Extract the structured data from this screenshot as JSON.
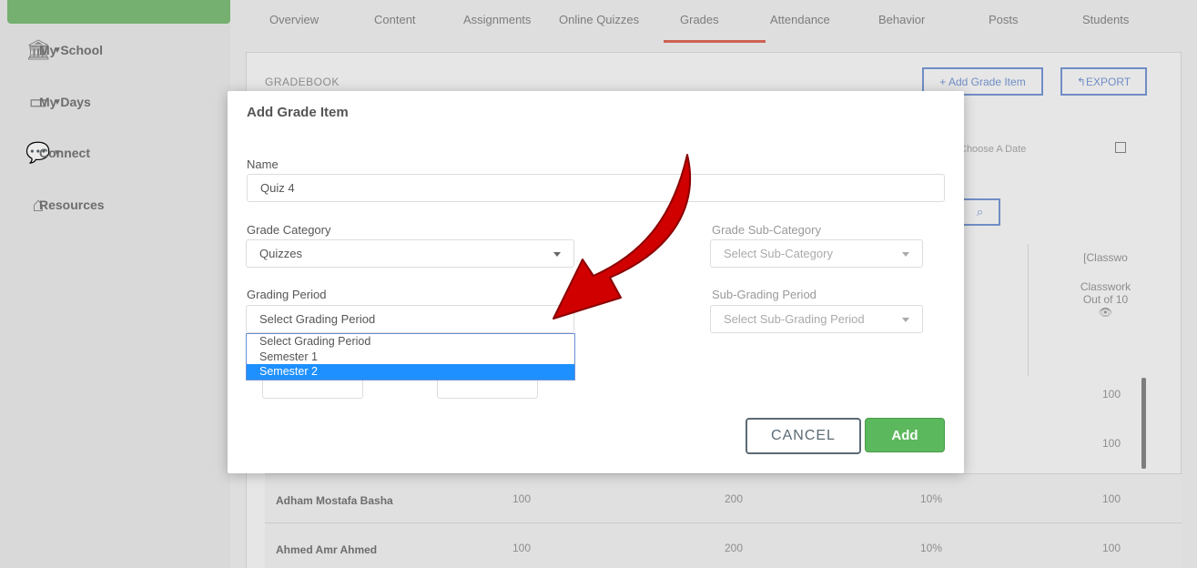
{
  "sidebar": {
    "items": [
      {
        "label": "My School",
        "icon": "school-icon"
      },
      {
        "label": "My Days",
        "icon": "calendar-icon"
      },
      {
        "label": "Connect",
        "icon": "chat-icon"
      },
      {
        "label": "Resources",
        "icon": "resources-icon"
      }
    ]
  },
  "tabs": [
    "Overview",
    "Content",
    "Assignments",
    "Online Quizzes",
    "Grades",
    "Attendance",
    "Behavior",
    "Posts",
    "Students"
  ],
  "gradebook": {
    "title": "GRADEBOOK",
    "add_grade_item": "+ Add Grade Item",
    "export": "EXPORT",
    "date_placeholder": "Choose A Date",
    "col_header_top": "[Classwo",
    "col_header_sub": "Classwork",
    "col_header_sub2": "Out of 10",
    "students": [
      "Adham Mostafa Basha",
      "Ahmed Amr Ahmed"
    ],
    "values": [
      "100",
      "200",
      "10%",
      "100"
    ]
  },
  "modal": {
    "title": "Add Grade Item",
    "name_label": "Name",
    "name_value": "Quiz 4",
    "category_label": "Grade Category",
    "category_value": "Quizzes",
    "subcategory_label": "Grade Sub-Category",
    "subcategory_placeholder": "Select Sub-Category",
    "period_label": "Grading Period",
    "period_value": "Select Grading Period",
    "subperiod_label": "Sub-Grading Period",
    "subperiod_placeholder": "Select Sub-Grading Period",
    "period_options": [
      "Select Grading Period",
      "Semester 1",
      "Semester 2"
    ],
    "period_highlighted": "Semester 2",
    "cancel": "CANCEL",
    "add": "Add"
  },
  "colors": {
    "accent_green": "#5cb85c",
    "dropdown_highlight": "#1e90ff",
    "annotation_arrow": "#d00000"
  }
}
